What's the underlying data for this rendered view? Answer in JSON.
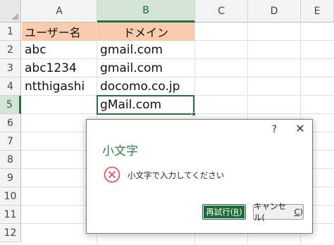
{
  "columns": [
    "A",
    "B",
    "C",
    "D",
    "E"
  ],
  "rows": [
    "1",
    "2",
    "3",
    "4",
    "5",
    "6",
    "7",
    "8",
    "9",
    "10",
    "11",
    "12"
  ],
  "cells": {
    "a1": "ユーザー名",
    "b1": "ドメイン",
    "a2": "abc",
    "b2": "gmail.com",
    "a3": "abc1234",
    "b3": "gmail.com",
    "a4": "ntthigashi",
    "b4": "docomo.co.jp",
    "b5": "gMail.com"
  },
  "colors": {
    "header_fill": "#f8cbad",
    "selection": "#217346",
    "dialog_title": "#2f7d47",
    "error_red": "#e04848"
  },
  "dialog": {
    "help": "?",
    "close": "✕",
    "title": "小文字",
    "icon": "error-circle-x",
    "message": "小文字で入力してください",
    "retry_label": "再試行(",
    "retry_key": "R",
    "retry_end": ")",
    "cancel_label": "キャンセル(",
    "cancel_key": "C",
    "cancel_end": ")"
  }
}
